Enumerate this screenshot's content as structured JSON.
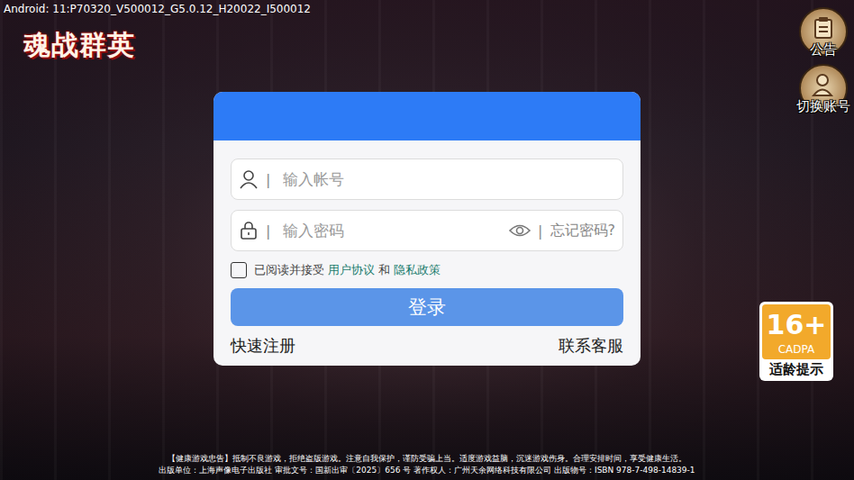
{
  "status": {
    "build": "Android: 11:P70320_V500012_G5.0.12_H20022_I500012"
  },
  "logo": {
    "title": "魂战群英"
  },
  "side_buttons": [
    {
      "label": "公告",
      "kind": "notice"
    },
    {
      "label": "切换账号",
      "kind": "account"
    }
  ],
  "login": {
    "account": {
      "placeholder": "输入帐号"
    },
    "password": {
      "placeholder": "输入密码",
      "forgot": "忘记密码?"
    },
    "separator": "|",
    "agreement": {
      "checked": false,
      "prefix": "已阅读并接受",
      "user_agreement": "用户协议",
      "and": "和",
      "privacy": "隐私政策"
    },
    "submit": "登录",
    "register": "快速注册",
    "support": "联系客服"
  },
  "age_badge": {
    "rating": "16+",
    "org": "CADPA",
    "caption": "适龄提示"
  },
  "footer": [
    "【健康游戏忠告】抵制不良游戏，拒绝盗版游戏。注意自我保护，谨防受骗上当。适度游戏益脑，沉迷游戏伤身。合理安排时间，享受健康生活。",
    "出版单位：上海声像电子出版社 审批文号：国新出审〔2025〕656 号 著作权人：广州天余网络科技有限公司 出版物号：ISBN 978-7-498-14839-1"
  ]
}
